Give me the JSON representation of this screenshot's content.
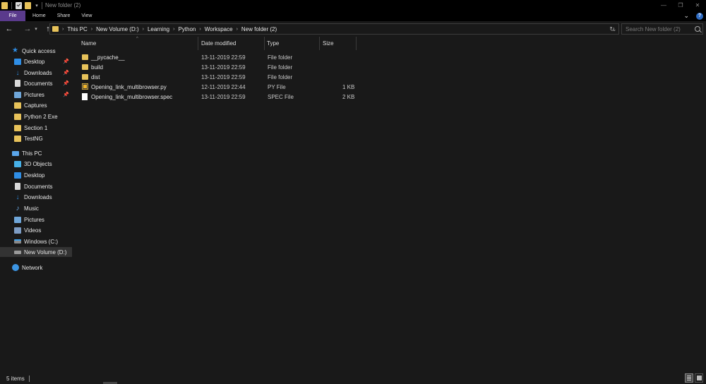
{
  "window": {
    "title": "New folder (2)",
    "controls": {
      "minimize": "—",
      "maximize": "❐",
      "close": "✕"
    }
  },
  "ribbon": {
    "tabs": [
      "File",
      "Home",
      "Share",
      "View"
    ],
    "expand_glyph": "⌄",
    "help_glyph": "?"
  },
  "address": {
    "breadcrumbs": [
      "This PC",
      "New Volume (D:)",
      "Learning",
      "Python",
      "Workspace",
      "New folder (2)"
    ],
    "search_placeholder": "Search New folder (2)"
  },
  "nav_pane": {
    "quick_access": {
      "label": "Quick access",
      "items": [
        {
          "label": "Desktop",
          "icon": "desktop-icon",
          "pinned": true
        },
        {
          "label": "Downloads",
          "icon": "downloads-icon",
          "pinned": true
        },
        {
          "label": "Documents",
          "icon": "documents-icon",
          "pinned": true
        },
        {
          "label": "Pictures",
          "icon": "pictures-icon",
          "pinned": true
        },
        {
          "label": "Captures",
          "icon": "folder-icon",
          "pinned": false
        },
        {
          "label": "Python 2 Exe",
          "icon": "folder-icon",
          "pinned": false
        },
        {
          "label": "Section 1",
          "icon": "folder-icon",
          "pinned": false
        },
        {
          "label": "TestNG",
          "icon": "folder-icon",
          "pinned": false
        }
      ]
    },
    "this_pc": {
      "label": "This PC",
      "items": [
        {
          "label": "3D Objects",
          "icon": "3d-objects-icon"
        },
        {
          "label": "Desktop",
          "icon": "desktop-icon"
        },
        {
          "label": "Documents",
          "icon": "documents-icon"
        },
        {
          "label": "Downloads",
          "icon": "downloads-icon"
        },
        {
          "label": "Music",
          "icon": "music-icon"
        },
        {
          "label": "Pictures",
          "icon": "pictures-icon"
        },
        {
          "label": "Videos",
          "icon": "videos-icon"
        },
        {
          "label": "Windows (C:)",
          "icon": "windows-drive-icon"
        },
        {
          "label": "New Volume (D:)",
          "icon": "drive-icon",
          "selected": true
        }
      ]
    },
    "network": {
      "label": "Network"
    }
  },
  "file_list": {
    "columns": [
      "Name",
      "Date modified",
      "Type",
      "Size"
    ],
    "rows": [
      {
        "name": "__pycache__",
        "date": "13-11-2019 22:59",
        "type": "File folder",
        "size": "",
        "icon": "folder-icon"
      },
      {
        "name": "build",
        "date": "13-11-2019 22:59",
        "type": "File folder",
        "size": "",
        "icon": "folder-icon"
      },
      {
        "name": "dist",
        "date": "13-11-2019 22:59",
        "type": "File folder",
        "size": "",
        "icon": "folder-icon"
      },
      {
        "name": "Opening_link_multibrowser.py",
        "date": "12-11-2019 22:44",
        "type": "PY File",
        "size": "1 KB",
        "icon": "python-file-icon"
      },
      {
        "name": "Opening_link_multibrowser.spec",
        "date": "13-11-2019 22:59",
        "type": "SPEC File",
        "size": "2 KB",
        "icon": "file-icon"
      }
    ]
  },
  "status": {
    "item_count": "5 items"
  },
  "colors": {
    "file_tab": "#5a3a8c",
    "folder": "#e7c25a",
    "accent_blue": "#2f8ee6",
    "background": "#191919"
  }
}
